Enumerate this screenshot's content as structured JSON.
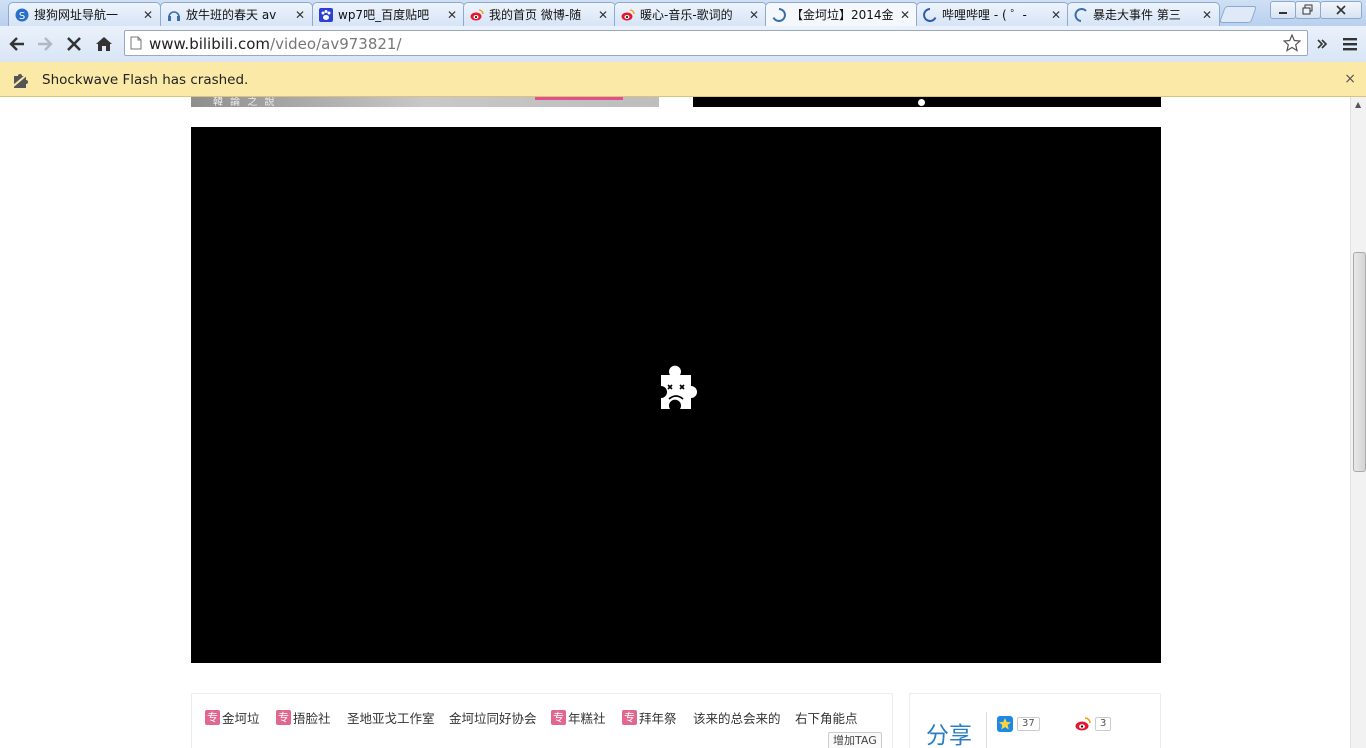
{
  "tabs": [
    {
      "title": "搜狗网址导航一",
      "icon": "sogou-icon"
    },
    {
      "title": "放牛班的春天  av",
      "icon": "headphones-icon"
    },
    {
      "title": "wp7吧_百度贴吧",
      "icon": "baidu-paw-icon"
    },
    {
      "title": "我的首页  微博-随",
      "icon": "weibo-icon"
    },
    {
      "title": "暖心-音乐-歌词的",
      "icon": "weibo-icon"
    },
    {
      "title": "【金坷垃】2014金",
      "icon": "loading-spinner-icon"
    },
    {
      "title": "哔哩哔哩 - ( ゜-",
      "icon": "loading-spinner-icon"
    },
    {
      "title": "暴走大事件  第三",
      "icon": "loading-spinner-icon"
    }
  ],
  "active_tab": 5,
  "toolbar": {
    "url_host": "www.bilibili.com",
    "url_path": "/video/av973821/"
  },
  "infobar": {
    "message": "Shockwave Flash has crashed.",
    "close": "×"
  },
  "tags": [
    {
      "label": "金坷垃",
      "special": true
    },
    {
      "label": "捂脸社",
      "special": true
    },
    {
      "label": "圣地亚戈工作室",
      "special": false
    },
    {
      "label": "金坷垃同好协会",
      "special": false
    },
    {
      "label": "年糕社",
      "special": true
    },
    {
      "label": "拜年祭",
      "special": true
    },
    {
      "label": "该来的总会来的",
      "special": false
    },
    {
      "label": "右下角能点",
      "special": false
    }
  ],
  "tag_special_mark": "专",
  "add_tag_label": "增加TAG",
  "share": {
    "title": "分享",
    "qzone_count": "37",
    "weibo_count": "3"
  },
  "thumb_caption": "韓 論 之 說",
  "colors": {
    "accent_pink": "#e2678e",
    "share_blue": "#2a7fc4",
    "infobar_bg": "#fbe9a8"
  }
}
